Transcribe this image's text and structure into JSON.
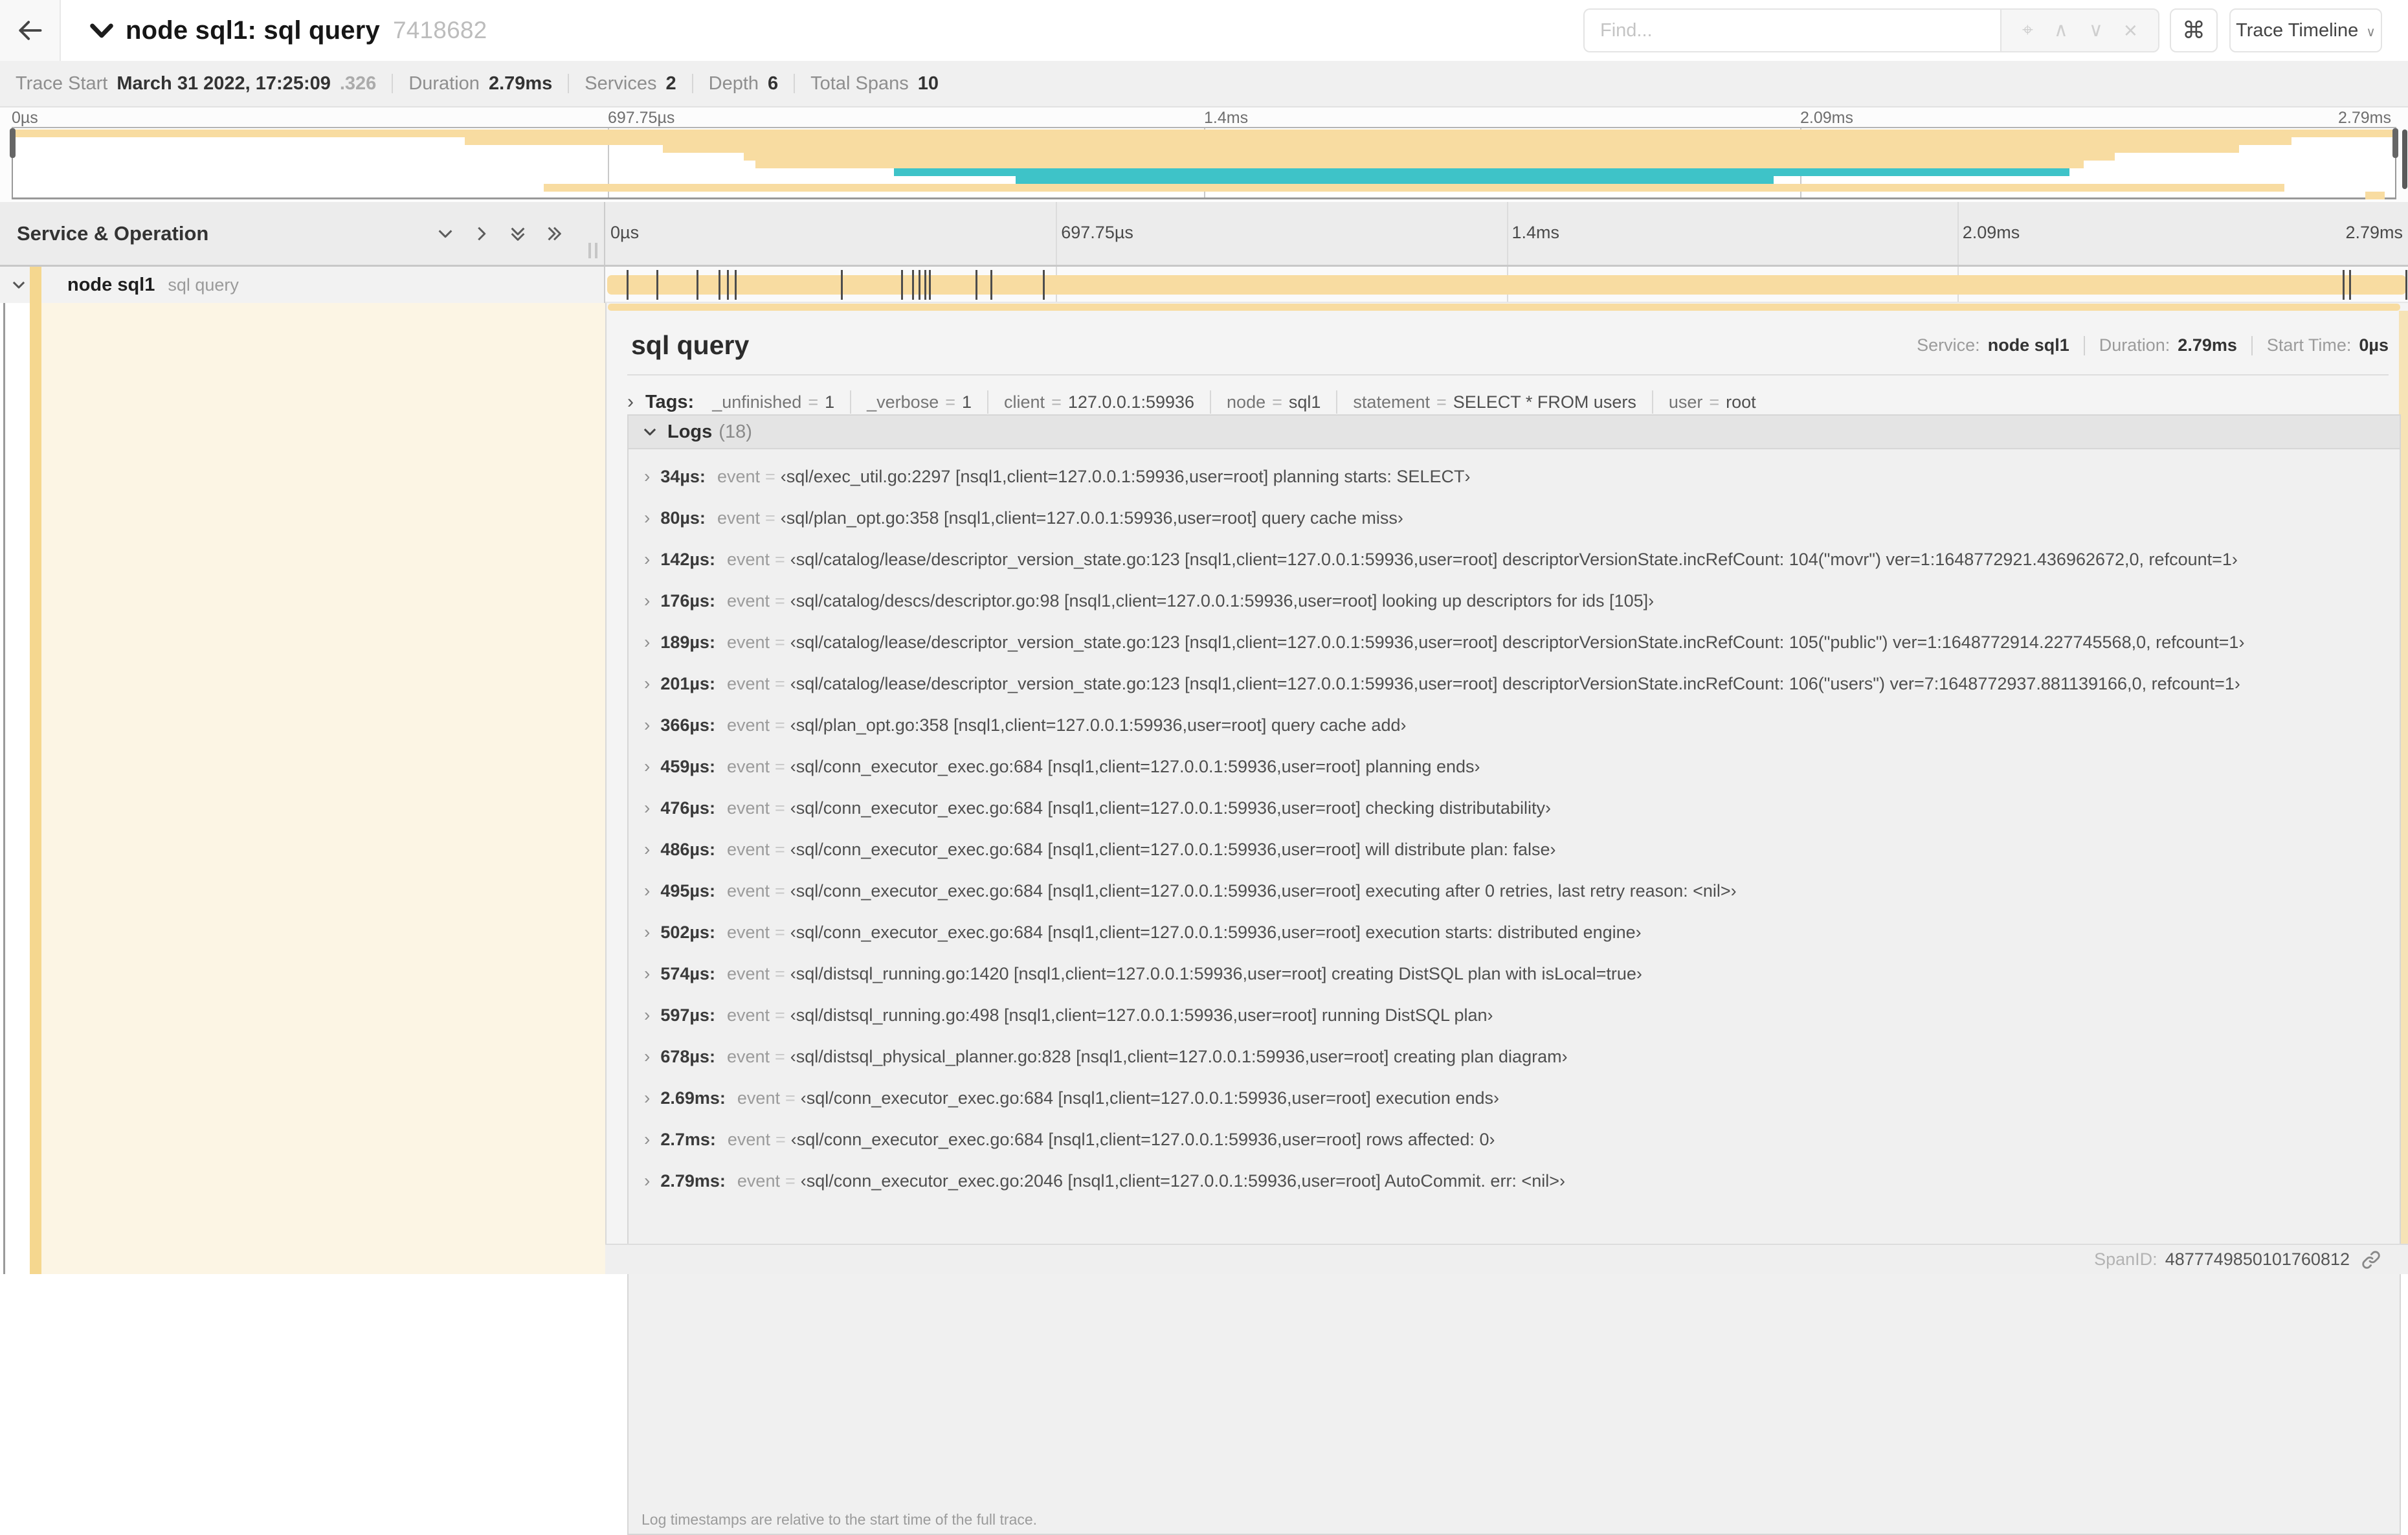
{
  "colors": {
    "span_tan": "#F8DCA1",
    "span_teal": "#3EC3C8",
    "accent_bar": "#F5D78F",
    "detail_row_cream": "#FCF5E4"
  },
  "header": {
    "title": "node sql1: sql query",
    "trace_id_short": "7418682",
    "find_placeholder": "Find...",
    "shortcut_label": "⌘",
    "view_dropdown_label": "Trace Timeline",
    "find_icons": [
      "crosshair",
      "chevron-up",
      "chevron-down",
      "close"
    ]
  },
  "trace_info": {
    "items": [
      {
        "label": "Trace Start",
        "value": "March 31 2022, 17:25:09",
        "suffix": ".326"
      },
      {
        "label": "Duration",
        "value": "2.79ms",
        "suffix": ""
      },
      {
        "label": "Services",
        "value": "2",
        "suffix": ""
      },
      {
        "label": "Depth",
        "value": "6",
        "suffix": ""
      },
      {
        "label": "Total Spans",
        "value": "10",
        "suffix": ""
      }
    ]
  },
  "time_ticks": [
    {
      "label": "0µs",
      "pos": 0
    },
    {
      "label": "697.75µs",
      "pos": 25
    },
    {
      "label": "1.4ms",
      "pos": 50
    },
    {
      "label": "2.09ms",
      "pos": 75
    },
    {
      "label": "2.79ms",
      "pos": 100
    }
  ],
  "minimap": {
    "spans": [
      {
        "start": 0.0,
        "end": 100.0,
        "color": "tan"
      },
      {
        "start": 19.0,
        "end": 95.6,
        "color": "tan"
      },
      {
        "start": 27.3,
        "end": 93.4,
        "color": "tan"
      },
      {
        "start": 30.7,
        "end": 88.2,
        "color": "tan"
      },
      {
        "start": 31.2,
        "end": 86.9,
        "color": "tan"
      },
      {
        "start": 37.0,
        "end": 86.3,
        "color": "teal"
      },
      {
        "start": 42.1,
        "end": 73.9,
        "color": "teal"
      },
      {
        "start": 22.3,
        "end": 95.3,
        "color": "tan"
      },
      {
        "start": 98.7,
        "end": 99.5,
        "color": "tan"
      }
    ]
  },
  "timeline": {
    "left_header": "Service & Operation",
    "span_row": {
      "service": "node sql1",
      "operation": "sql query",
      "bar_start_pct": 0,
      "bar_end_pct": 100,
      "log_marker_pcts": [
        1.22,
        2.87,
        5.09,
        6.31,
        6.77,
        7.2,
        13.12,
        16.45,
        17.06,
        17.42,
        17.74,
        17.99,
        20.57,
        21.4,
        24.3,
        96.42,
        96.77,
        99.9
      ]
    }
  },
  "detail": {
    "title": "sql query",
    "meta": [
      {
        "label": "Service:",
        "value": "node sql1"
      },
      {
        "label": "Duration:",
        "value": "2.79ms"
      },
      {
        "label": "Start Time:",
        "value": "0µs"
      }
    ],
    "tags_label": "Tags:",
    "tags": [
      {
        "key": "_unfinished",
        "value": "1"
      },
      {
        "key": "_verbose",
        "value": "1"
      },
      {
        "key": "client",
        "value": "127.0.0.1:59936"
      },
      {
        "key": "node",
        "value": "sql1"
      },
      {
        "key": "statement",
        "value": "SELECT * FROM users"
      },
      {
        "key": "user",
        "value": "root"
      }
    ],
    "logs": {
      "label": "Logs",
      "count": "(18)",
      "field_name": "event",
      "entries": [
        {
          "time": "34µs:",
          "value": "sql/exec_util.go:2297 [nsql1,client=127.0.0.1:59936,user=root] planning starts: SELECT"
        },
        {
          "time": "80µs:",
          "value": "sql/plan_opt.go:358 [nsql1,client=127.0.0.1:59936,user=root] query cache miss"
        },
        {
          "time": "142µs:",
          "value": "sql/catalog/lease/descriptor_version_state.go:123 [nsql1,client=127.0.0.1:59936,user=root] descriptorVersionState.incRefCount: 104(\"movr\") ver=1:1648772921.436962672,0, refcount=1"
        },
        {
          "time": "176µs:",
          "value": "sql/catalog/descs/descriptor.go:98 [nsql1,client=127.0.0.1:59936,user=root] looking up descriptors for ids [105]"
        },
        {
          "time": "189µs:",
          "value": "sql/catalog/lease/descriptor_version_state.go:123 [nsql1,client=127.0.0.1:59936,user=root] descriptorVersionState.incRefCount: 105(\"public\") ver=1:1648772914.227745568,0, refcount=1"
        },
        {
          "time": "201µs:",
          "value": "sql/catalog/lease/descriptor_version_state.go:123 [nsql1,client=127.0.0.1:59936,user=root] descriptorVersionState.incRefCount: 106(\"users\") ver=7:1648772937.881139166,0, refcount=1"
        },
        {
          "time": "366µs:",
          "value": "sql/plan_opt.go:358 [nsql1,client=127.0.0.1:59936,user=root] query cache add"
        },
        {
          "time": "459µs:",
          "value": "sql/conn_executor_exec.go:684 [nsql1,client=127.0.0.1:59936,user=root] planning ends"
        },
        {
          "time": "476µs:",
          "value": "sql/conn_executor_exec.go:684 [nsql1,client=127.0.0.1:59936,user=root] checking distributability"
        },
        {
          "time": "486µs:",
          "value": "sql/conn_executor_exec.go:684 [nsql1,client=127.0.0.1:59936,user=root] will distribute plan: false"
        },
        {
          "time": "495µs:",
          "value": "sql/conn_executor_exec.go:684 [nsql1,client=127.0.0.1:59936,user=root] executing after 0 retries, last retry reason: <nil>"
        },
        {
          "time": "502µs:",
          "value": "sql/conn_executor_exec.go:684 [nsql1,client=127.0.0.1:59936,user=root] execution starts: distributed engine"
        },
        {
          "time": "574µs:",
          "value": "sql/distsql_running.go:1420 [nsql1,client=127.0.0.1:59936,user=root] creating DistSQL plan with isLocal=true"
        },
        {
          "time": "597µs:",
          "value": "sql/distsql_running.go:498 [nsql1,client=127.0.0.1:59936,user=root] running DistSQL plan"
        },
        {
          "time": "678µs:",
          "value": "sql/distsql_physical_planner.go:828 [nsql1,client=127.0.0.1:59936,user=root] creating plan diagram"
        },
        {
          "time": "2.69ms:",
          "value": "sql/conn_executor_exec.go:684 [nsql1,client=127.0.0.1:59936,user=root] execution ends"
        },
        {
          "time": "2.7ms:",
          "value": "sql/conn_executor_exec.go:684 [nsql1,client=127.0.0.1:59936,user=root] rows affected: 0"
        },
        {
          "time": "2.79ms:",
          "value": "sql/conn_executor_exec.go:2046 [nsql1,client=127.0.0.1:59936,user=root] AutoCommit. err: <nil>"
        }
      ],
      "footnote": "Log timestamps are relative to the start time of the full trace."
    },
    "footer": {
      "label": "SpanID:",
      "value": "4877749850101760812"
    }
  }
}
